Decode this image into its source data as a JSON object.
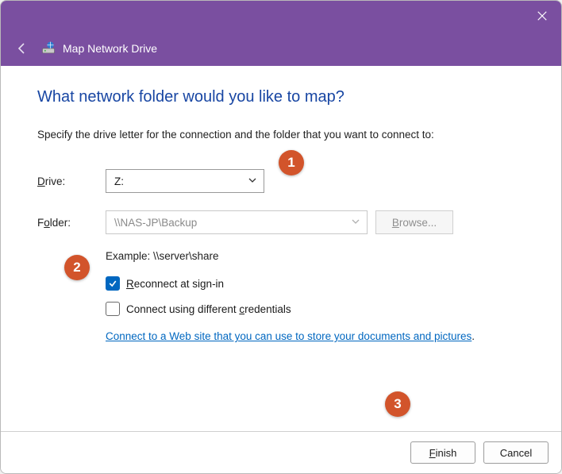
{
  "window": {
    "title": "Map Network Drive"
  },
  "heading": "What network folder would you like to map?",
  "instruction": "Specify the drive letter for the connection and the folder that you want to connect to:",
  "labels": {
    "drive_prefix": "D",
    "drive_rest": "rive:",
    "folder_prefix": "F",
    "folder_mid": "o",
    "folder_rest": "lder:"
  },
  "drive": {
    "value": "Z:"
  },
  "folder": {
    "placeholder": "\\\\NAS-JP\\Backup"
  },
  "browse": {
    "prefix": "B",
    "rest": "rowse..."
  },
  "example": "Example: \\\\server\\share",
  "reconnect": {
    "checked": true,
    "prefix": "R",
    "rest": "econnect at sign-in"
  },
  "diffcreds": {
    "checked": false,
    "label_pre": "Connect using different ",
    "underline": "c",
    "label_post": "redentials"
  },
  "link": {
    "text": "Connect to a Web site that you can use to store your documents and pictures",
    "trail": "."
  },
  "buttons": {
    "finish_prefix": "F",
    "finish_rest": "inish",
    "cancel": "Cancel"
  },
  "annotations": {
    "a1": "1",
    "a2": "2",
    "a3": "3"
  }
}
